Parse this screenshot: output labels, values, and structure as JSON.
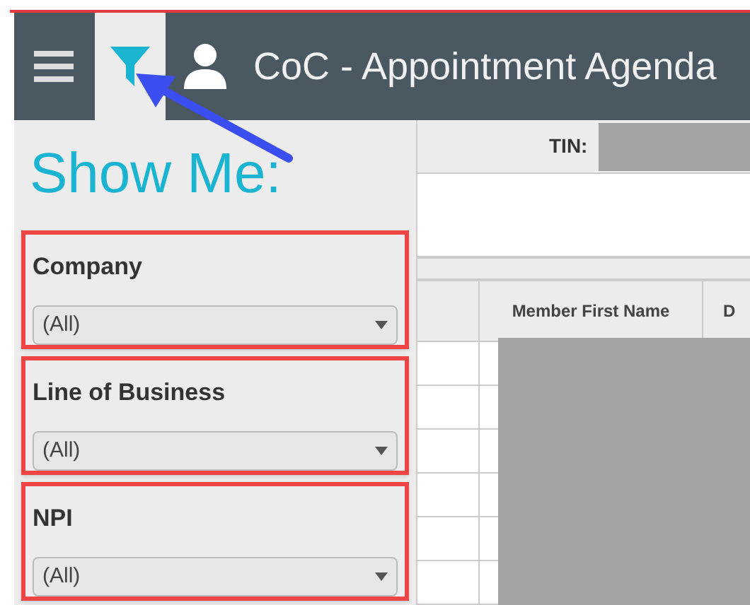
{
  "header": {
    "title": "CoC - Appointment Agenda"
  },
  "filter_panel": {
    "title": "Show Me:",
    "filters": [
      {
        "label": "Company",
        "value": "(All)",
        "highlighted": true
      },
      {
        "label": "Line of Business",
        "value": "(All)",
        "highlighted": true
      },
      {
        "label": "NPI",
        "value": "(All)",
        "highlighted": true
      }
    ]
  },
  "tin": {
    "label": "TIN:"
  },
  "table": {
    "columns": [
      "Member First Name",
      "D"
    ]
  }
}
